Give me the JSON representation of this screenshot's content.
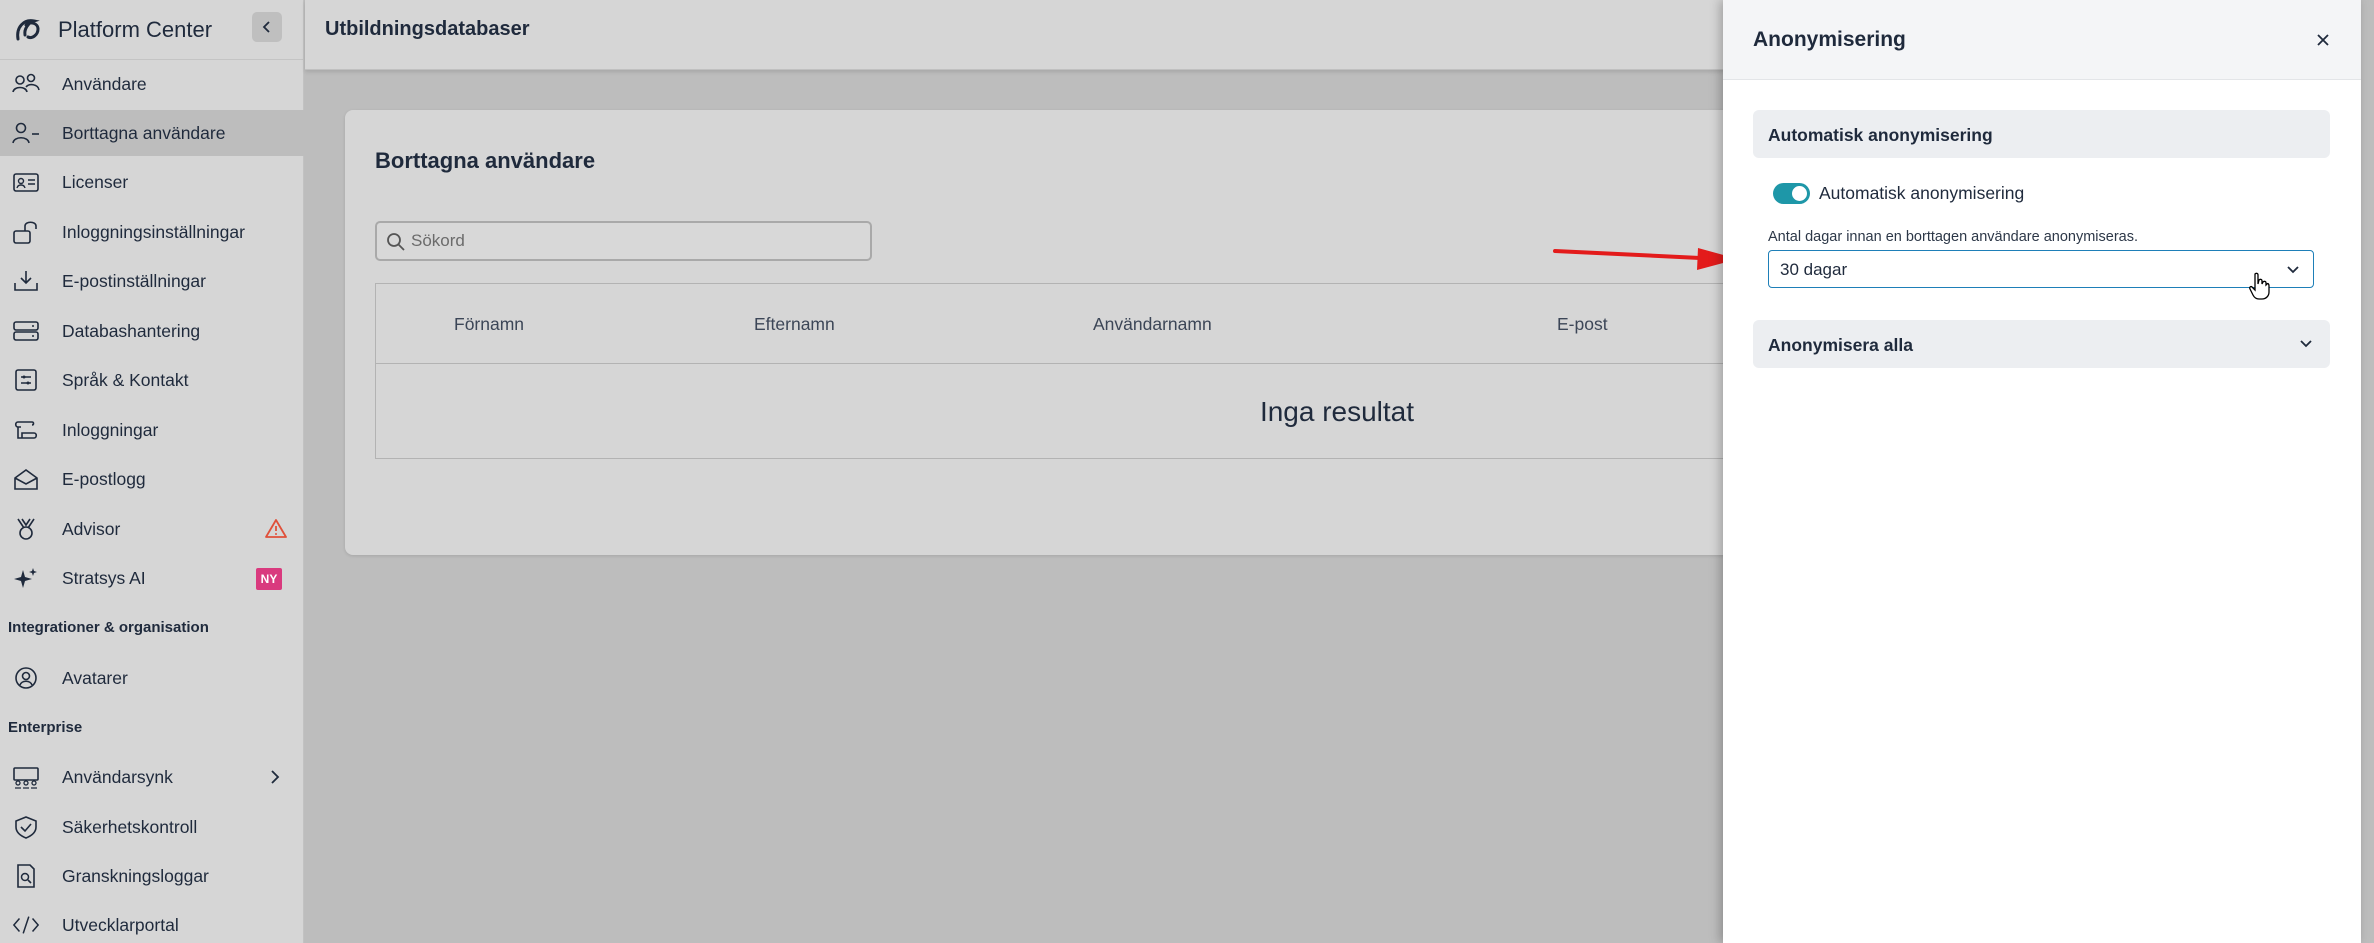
{
  "sidebar": {
    "brand": "Platform Center",
    "items": [
      {
        "label": "Användare",
        "icon": "users-icon"
      },
      {
        "label": "Borttagna användare",
        "icon": "user-minus-icon",
        "active": true
      },
      {
        "label": "Licenser",
        "icon": "id-card-icon"
      },
      {
        "label": "Inloggningsinställningar",
        "icon": "unlock-icon"
      },
      {
        "label": "E-postinställningar",
        "icon": "download-tray-icon"
      },
      {
        "label": "Databashantering",
        "icon": "server-icon"
      },
      {
        "label": "Språk & Kontakt",
        "icon": "settings-panel-icon"
      },
      {
        "label": "Inloggningar",
        "icon": "scroll-icon"
      },
      {
        "label": "E-postlogg",
        "icon": "mail-open-icon"
      },
      {
        "label": "Advisor",
        "icon": "medal-icon",
        "alert": "warning-icon"
      },
      {
        "label": "Stratsys AI",
        "icon": "sparkles-icon",
        "badge": "NY"
      }
    ],
    "section_integrations": "Integrationer & organisation",
    "integrations_items": [
      {
        "label": "Avatarer",
        "icon": "user-circle-icon"
      }
    ],
    "section_enterprise": "Enterprise",
    "enterprise_items": [
      {
        "label": "Användarsynk",
        "icon": "team-sync-icon"
      },
      {
        "label": "Säkerhetskontroll",
        "icon": "shield-check-icon"
      },
      {
        "label": "Granskningsloggar",
        "icon": "document-search-icon"
      },
      {
        "label": "Utvecklarportal",
        "icon": "code-icon"
      }
    ]
  },
  "topbar": {
    "title": "Utbildningsdatabaser"
  },
  "main": {
    "title": "Borttagna användare",
    "search_placeholder": "Sökord",
    "columns": [
      "Förnamn",
      "Efternamn",
      "Användarnamn",
      "E-post"
    ],
    "empty_text": "Inga resultat"
  },
  "drawer": {
    "title": "Anonymisering",
    "auto_section": "Automatisk anonymisering",
    "toggle_label": "Automatisk anonymisering",
    "toggle_on": true,
    "field_label": "Antal dagar innan en borttagen användare anonymiseras.",
    "select_value": "30 dagar",
    "all_section": "Anonymisera alla"
  },
  "colors": {
    "accent": "#1e97a8",
    "badge": "#d93a7e",
    "warning": "#e0503a",
    "annotation_arrow": "#e31b1b"
  }
}
